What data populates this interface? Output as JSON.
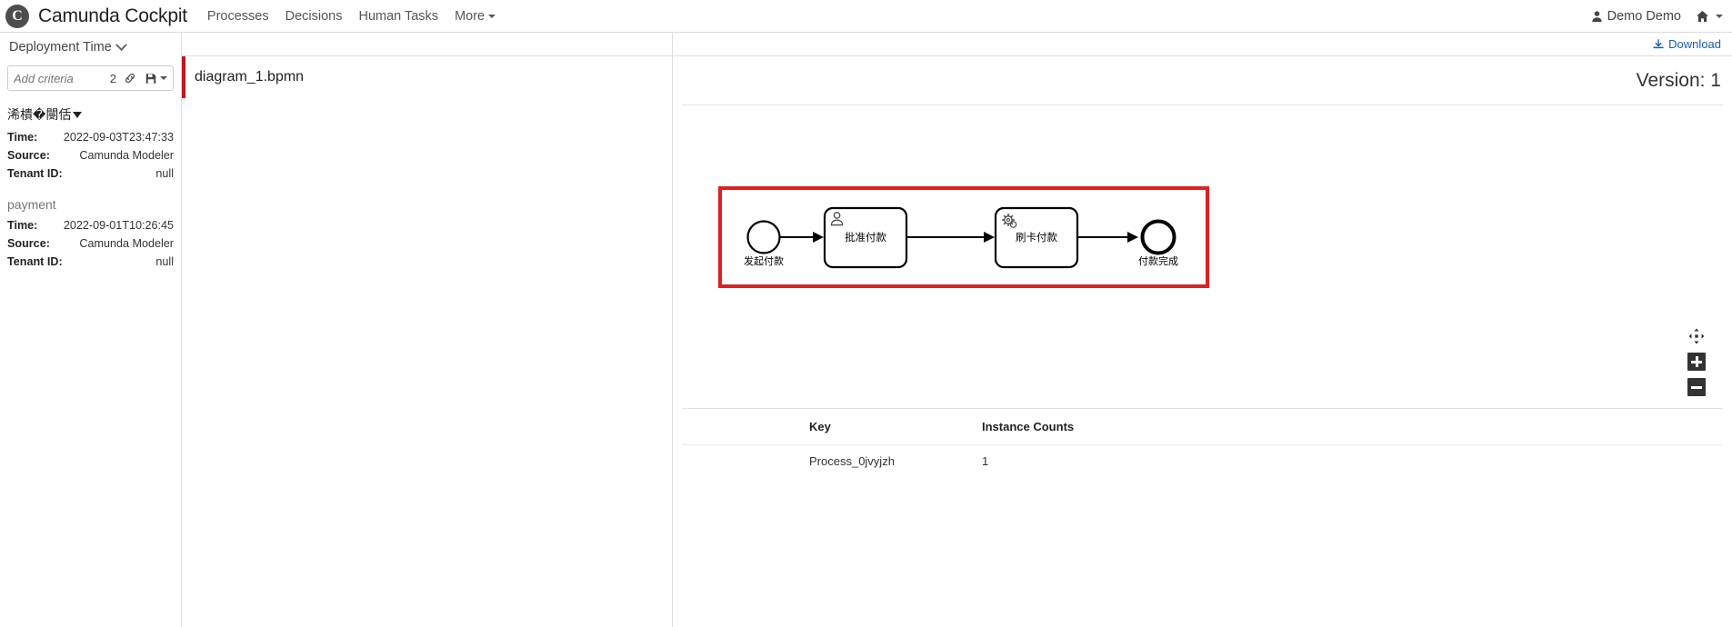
{
  "navbar": {
    "brand_title": "Camunda Cockpit",
    "logo_glyph": "C",
    "links": [
      {
        "label": "Processes"
      },
      {
        "label": "Decisions"
      },
      {
        "label": "Human Tasks"
      },
      {
        "label": "More"
      }
    ],
    "user_name": "Demo Demo"
  },
  "sidebar": {
    "section_title": "Deployment Time",
    "search": {
      "placeholder": "Add criteria",
      "value": "",
      "count": "2"
    },
    "deployments": [
      {
        "name": "浠樻�閿佸",
        "rows": [
          {
            "key": "Time:",
            "value": "2022-09-03T23:47:33"
          },
          {
            "key": "Source:",
            "value": "Camunda Modeler"
          },
          {
            "key": "Tenant ID:",
            "value": "null"
          }
        ]
      },
      {
        "name": "payment",
        "rows": [
          {
            "key": "Time:",
            "value": "2022-09-01T10:26:45"
          },
          {
            "key": "Source:",
            "value": "Camunda Modeler"
          },
          {
            "key": "Tenant ID:",
            "value": "null"
          }
        ]
      }
    ]
  },
  "resources": {
    "items": [
      {
        "name": "diagram_1.bpmn"
      }
    ]
  },
  "rightpane": {
    "download_label": "Download",
    "version_label": "Version: 1"
  },
  "diagram": {
    "start_event_label": "发起付款",
    "user_task_label": "批准付款",
    "service_task_label": "刷卡付款",
    "end_event_label": "付款完成",
    "highlight_color": "#e02020"
  },
  "table": {
    "headers": [
      {
        "label": "Key"
      },
      {
        "label": "Instance Counts"
      }
    ],
    "rows": [
      {
        "key": "Process_0jvyjzh",
        "count": "1"
      }
    ]
  }
}
